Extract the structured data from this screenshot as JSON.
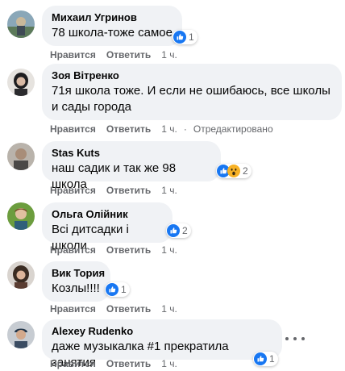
{
  "colors": {
    "bubble": "#f0f2f5",
    "action_text": "#65676b",
    "like_blue": "#1877f2",
    "wow_yellow": "#f7b125"
  },
  "actions": {
    "like": "Нравится",
    "reply": "Ответить"
  },
  "comments": [
    {
      "author": "Михаил Угринов",
      "text": "78 школа-тоже самое",
      "time": "1 ч.",
      "reactions": [
        "like-icon"
      ],
      "reaction_count": "1"
    },
    {
      "author": "Зоя Вітренко",
      "text": "71я школа тоже. И если не ошибаюсь, все школы и сады города",
      "time": "1 ч.",
      "edited": "Отредактировано"
    },
    {
      "author": "Stas Kuts",
      "text": "наш садик и так же 98 школа",
      "time": "1 ч.",
      "reactions": [
        "like-icon",
        "wow-icon"
      ],
      "reaction_count": "2"
    },
    {
      "author": "Ольга Олійник",
      "text": "Всі дитсадки і школи",
      "time": "1 ч.",
      "reactions": [
        "like-icon"
      ],
      "reaction_count": "2"
    },
    {
      "author": "Вик Тория",
      "text": "Козлы!!!!",
      "time": "1 ч.",
      "reactions": [
        "like-icon"
      ],
      "reaction_count": "1"
    },
    {
      "author": "Alexey Rudenko",
      "text": "даже музыкалка #1 прекратила занятия",
      "time": "1 ч.",
      "reactions": [
        "like-icon"
      ],
      "reaction_count": "1",
      "more_icon": "more-options-icon"
    }
  ]
}
